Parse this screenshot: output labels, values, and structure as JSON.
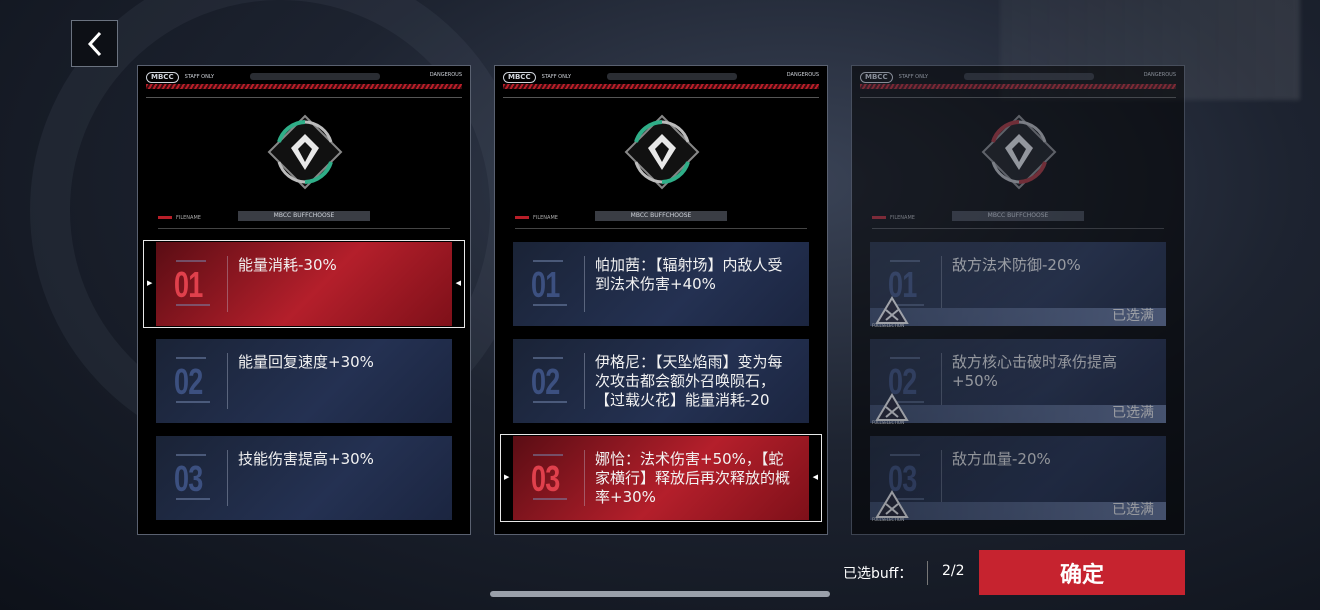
{
  "header": {
    "back_icon": "chevron-left-icon"
  },
  "card_header": {
    "logo": "MBCC",
    "staff": "STAFF ONLY",
    "right": "DANGEROUS",
    "buff_tag": "MBCC BUFFCHOOSE",
    "filename": "FILENAME"
  },
  "panels": [
    {
      "emblem_color": "#2fae88",
      "dim": false,
      "options": [
        {
          "num": "01",
          "text": "能量消耗-30%",
          "selected": true,
          "full": false
        },
        {
          "num": "02",
          "text": "能量回复速度+30%",
          "selected": false,
          "full": false
        },
        {
          "num": "03",
          "text": "技能伤害提高+30%",
          "selected": false,
          "full": false
        }
      ]
    },
    {
      "emblem_color": "#2fae88",
      "dim": false,
      "options": [
        {
          "num": "01",
          "text": "帕加茜：【辐射场】内敌人受到法术伤害+40%",
          "selected": false,
          "full": false
        },
        {
          "num": "02",
          "text": "伊格尼：【天坠焰雨】变为每次攻击都会额外召唤陨石，【过载火花】能量消耗-20",
          "selected": false,
          "full": false
        },
        {
          "num": "03",
          "text": "娜恰：法术伤害+50%，【蛇家横行】释放后再次释放的概率+30%",
          "selected": true,
          "full": false
        }
      ]
    },
    {
      "emblem_color": "#a82a30",
      "dim": true,
      "options": [
        {
          "num": "01",
          "text": "敌方法术防御-20%",
          "selected": false,
          "full": true
        },
        {
          "num": "02",
          "text": "敌方核心击破时承伤提高+50%",
          "selected": false,
          "full": true
        },
        {
          "num": "03",
          "text": "敌方血量-20%",
          "selected": false,
          "full": true
        }
      ]
    }
  ],
  "full_label": "已选满",
  "full_sub": "FULLSELECTION",
  "footer": {
    "selected_label": "已选buff：",
    "selected_count": "2/2",
    "confirm": "确定"
  },
  "colors": {
    "accent_red": "#c6232f",
    "option_blue": "#243152"
  }
}
